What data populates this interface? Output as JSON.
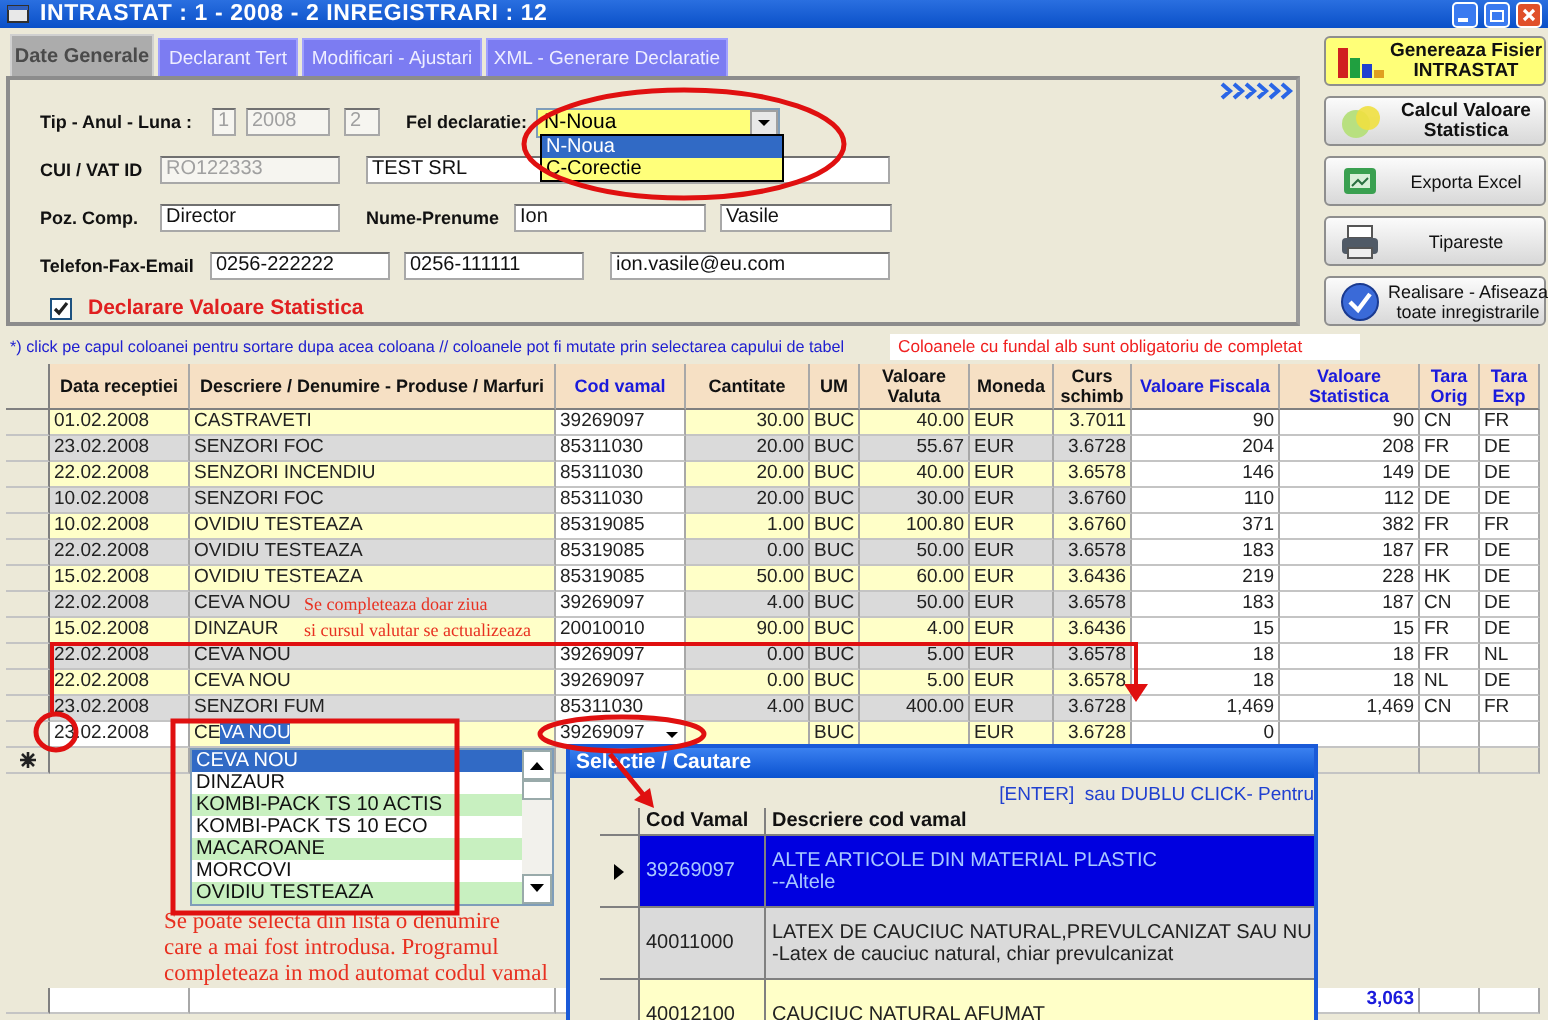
{
  "window": {
    "title": "INTRASTAT : 1 - 2008 - 2 INREGISTRARI : 12"
  },
  "tabs": [
    {
      "label": "Date Generale",
      "selected": true
    },
    {
      "label": "Declarant Tert",
      "selected": false
    },
    {
      "label": "Modificari - Ajustari",
      "selected": false
    },
    {
      "label": "XML - Generare Declaratie",
      "selected": false
    }
  ],
  "form": {
    "rows": [
      {
        "items": [
          {
            "kind": "label",
            "text": "Tip - Anul - Luna :"
          },
          {
            "kind": "field",
            "value": "1",
            "disabled": true
          },
          {
            "kind": "field",
            "value": "2008",
            "disabled": true
          },
          {
            "kind": "field",
            "value": "2",
            "disabled": true
          },
          {
            "kind": "label",
            "text": "Fel declaratie:"
          },
          {
            "kind": "select",
            "value": "N-Noua",
            "expanded": true,
            "options": [
              {
                "label": "N-Noua",
                "selected": true
              },
              {
                "label": "C-Corectie",
                "selected": false
              }
            ]
          }
        ]
      },
      {
        "items": [
          {
            "kind": "label",
            "text": "CUI / VAT ID"
          },
          {
            "kind": "field",
            "value": "RO122333",
            "disabled": true
          },
          {
            "kind": "field",
            "value": "TEST SRL",
            "disabled": false
          }
        ]
      },
      {
        "items": [
          {
            "kind": "label",
            "text": "Poz. Comp."
          },
          {
            "kind": "field",
            "value": "Director",
            "disabled": false
          },
          {
            "kind": "label",
            "text": "Nume-Prenume"
          },
          {
            "kind": "field",
            "value": "Ion",
            "disabled": false
          },
          {
            "kind": "field",
            "value": "Vasile",
            "disabled": false
          }
        ]
      },
      {
        "items": [
          {
            "kind": "label",
            "text": "Telefon-Fax-Email"
          },
          {
            "kind": "field",
            "value": "0256-222222",
            "disabled": false
          },
          {
            "kind": "field",
            "value": "0256-111111",
            "disabled": false
          },
          {
            "kind": "field",
            "value": "ion.vasile@eu.com",
            "disabled": false
          }
        ]
      }
    ],
    "checkbox": {
      "label": "Declarare Valoare Statistica",
      "checked": true
    }
  },
  "actions": [
    {
      "lines": [
        "Genereaza Fisier",
        "INTRASTAT"
      ],
      "highlighted": true
    },
    {
      "lines": [
        "Calcul Valoare",
        "Statistica"
      ],
      "highlighted": false
    },
    {
      "lines": [
        "Exporta Excel"
      ],
      "highlighted": false
    },
    {
      "lines": [
        "Tipareste"
      ],
      "highlighted": false
    },
    {
      "lines": [
        "Realisare - Afiseaza",
        "toate inregistrarile"
      ],
      "highlighted": false
    }
  ],
  "notes": {
    "hint": "*) click pe capul coloanei pentru sortare dupa acea coloana // coloanele pot fi mutate prin selectarea capului de tabel",
    "required": "Coloanele cu fundal alb sunt obligatoriu de completat"
  },
  "grid": {
    "columns": [
      {
        "label": "Data receptiei",
        "kind": "plain"
      },
      {
        "label": "Descriere / Denumire - Produse / Marfuri",
        "kind": "plain"
      },
      {
        "label": "Cod vamal",
        "kind": "required"
      },
      {
        "label": "Cantitate",
        "kind": "plain"
      },
      {
        "label": "UM",
        "kind": "plain"
      },
      {
        "label": "Valoare Valuta",
        "kind": "plain"
      },
      {
        "label": "Moneda",
        "kind": "plain"
      },
      {
        "label": "Curs schimb",
        "kind": "plain"
      },
      {
        "label": "Valoare Fiscala",
        "kind": "required"
      },
      {
        "label": "Valoare Statistica",
        "kind": "required"
      },
      {
        "label": "Tara Orig",
        "kind": "required"
      },
      {
        "label": "Tara Exp",
        "kind": "required"
      }
    ],
    "rows": [
      {
        "cells": [
          "01.02.2008",
          "CASTRAVETI",
          "39269097",
          "30.00",
          "BUC",
          "40.00",
          "EUR",
          "3.7011",
          "90",
          "90",
          "CN",
          "FR"
        ]
      },
      {
        "cells": [
          "23.02.2008",
          "SENZORI FOC",
          "85311030",
          "20.00",
          "BUC",
          "55.67",
          "EUR",
          "3.6728",
          "204",
          "208",
          "FR",
          "DE"
        ]
      },
      {
        "cells": [
          "22.02.2008",
          "SENZORI INCENDIU",
          "85311030",
          "20.00",
          "BUC",
          "40.00",
          "EUR",
          "3.6578",
          "146",
          "149",
          "DE",
          "DE"
        ]
      },
      {
        "cells": [
          "10.02.2008",
          "SENZORI FOC",
          "85311030",
          "20.00",
          "BUC",
          "30.00",
          "EUR",
          "3.6760",
          "110",
          "112",
          "DE",
          "DE"
        ]
      },
      {
        "cells": [
          "10.02.2008",
          "OVIDIU TESTEAZA",
          "85319085",
          "1.00",
          "BUC",
          "100.80",
          "EUR",
          "3.6760",
          "371",
          "382",
          "FR",
          "FR"
        ]
      },
      {
        "cells": [
          "22.02.2008",
          "OVIDIU TESTEAZA",
          "85319085",
          "0.00",
          "BUC",
          "50.00",
          "EUR",
          "3.6578",
          "183",
          "187",
          "FR",
          "DE"
        ]
      },
      {
        "cells": [
          "15.02.2008",
          "OVIDIU TESTEAZA",
          "85319085",
          "50.00",
          "BUC",
          "60.00",
          "EUR",
          "3.6436",
          "219",
          "228",
          "HK",
          "DE"
        ]
      },
      {
        "cells": [
          "22.02.2008",
          "CEVA NOU",
          "39269097",
          "4.00",
          "BUC",
          "50.00",
          "EUR",
          "3.6578",
          "183",
          "187",
          "CN",
          "DE"
        ]
      },
      {
        "cells": [
          "15.02.2008",
          "DINZAUR",
          "20010010",
          "90.00",
          "BUC",
          "4.00",
          "EUR",
          "3.6436",
          "15",
          "15",
          "FR",
          "DE"
        ]
      },
      {
        "cells": [
          "22.02.2008",
          "CEVA NOU",
          "39269097",
          "0.00",
          "BUC",
          "5.00",
          "EUR",
          "3.6578",
          "18",
          "18",
          "FR",
          "NL"
        ]
      },
      {
        "cells": [
          "22.02.2008",
          "CEVA NOU",
          "39269097",
          "0.00",
          "BUC",
          "5.00",
          "EUR",
          "3.6578",
          "18",
          "18",
          "NL",
          "DE"
        ]
      },
      {
        "cells": [
          "23.02.2008",
          "SENZORI FUM",
          "85311030",
          "4.00",
          "BUC",
          "400.00",
          "EUR",
          "3.6728",
          "1,469",
          "1,469",
          "CN",
          "FR"
        ]
      }
    ],
    "edit_row": {
      "date": "23.02.2008",
      "description": {
        "plain": "CE",
        "selected": "VA NOU"
      },
      "code": "39269097",
      "unit": "BUC",
      "currency": "EUR",
      "rate": "3.6728",
      "fiscal_value": "0"
    },
    "total": "3,063"
  },
  "description_list": {
    "items": [
      {
        "label": "CEVA NOU",
        "selected": true
      },
      {
        "label": "DINZAUR",
        "selected": false
      },
      {
        "label": "KOMBI-PACK TS 10 ACTIS",
        "selected": false
      },
      {
        "label": "KOMBI-PACK TS 10 ECO",
        "selected": false
      },
      {
        "label": "MACAROANE",
        "selected": false
      },
      {
        "label": "MORCOVI",
        "selected": false
      },
      {
        "label": "OVIDIU TESTEAZA",
        "selected": false
      }
    ]
  },
  "search_dialog": {
    "title": "Selectie / Cautare",
    "hint": "[ENTER]  sau DUBLU CLICK- Pentru",
    "columns": [
      "Cod Vamal",
      "Descriere cod vamal"
    ],
    "rows": [
      {
        "code": "39269097",
        "title": "ALTE ARTICOLE DIN MATERIAL PLASTIC",
        "subtitle": "--Altele",
        "selected": true
      },
      {
        "code": "40011000",
        "title": "LATEX DE CAUCIUC NATURAL,PREVULCANIZAT SAU NU",
        "subtitle": "-Latex de cauciuc natural, chiar prevulcanizat",
        "selected": false
      },
      {
        "code": "40012100",
        "title": "CAUCIUC NATURAL AFUMAT",
        "selected": false
      }
    ]
  },
  "annotations": [
    {
      "lines": [
        "Se completeaza doar ziua",
        "si cursul valutar se actualizeaza"
      ]
    },
    {
      "lines": [
        "Se poate selecta din lista o denumire",
        "care a mai fost introdusa. Programul",
        "completeaza in mod automat codul vamal"
      ]
    }
  ]
}
